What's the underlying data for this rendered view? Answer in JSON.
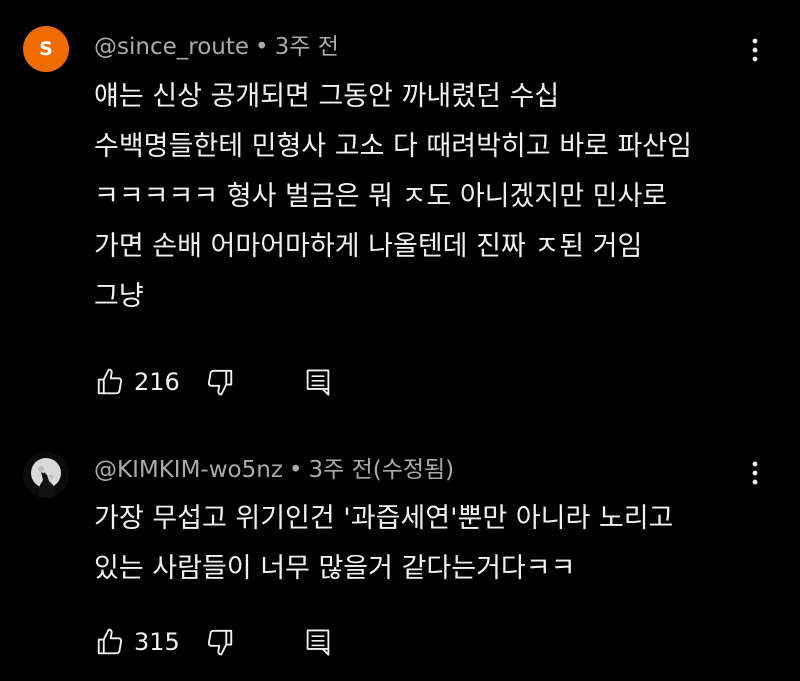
{
  "comments": [
    {
      "avatar_letter": "S",
      "avatar_color": "#ef6c00",
      "author": "@since_route",
      "time": "3주 전",
      "lines": [
        "얘는 신상 공개되면 그동안 까내렸던 수십",
        "수백명들한테 민형사 고소 다 때려박히고 바로 파산임",
        "ㅋㅋㅋㅋㅋ 형사 벌금은 뭐 ㅈ도 아니겠지만 민사로",
        "가면 손배 어마어마하게 나올텐데 진짜 ㅈ된 거임",
        "그냥"
      ],
      "likes": "216"
    },
    {
      "avatar_icon": "wolf-moon-icon",
      "author": "@KIMKIM-wo5nz",
      "time": "3주 전(수정됨)",
      "lines": [
        "가장 무섭고 위기인건 '과즙세연'뿐만 아니라 노리고",
        "있는 사람들이 너무 많을거 같다는거다ㅋㅋ"
      ],
      "likes": "315"
    }
  ]
}
